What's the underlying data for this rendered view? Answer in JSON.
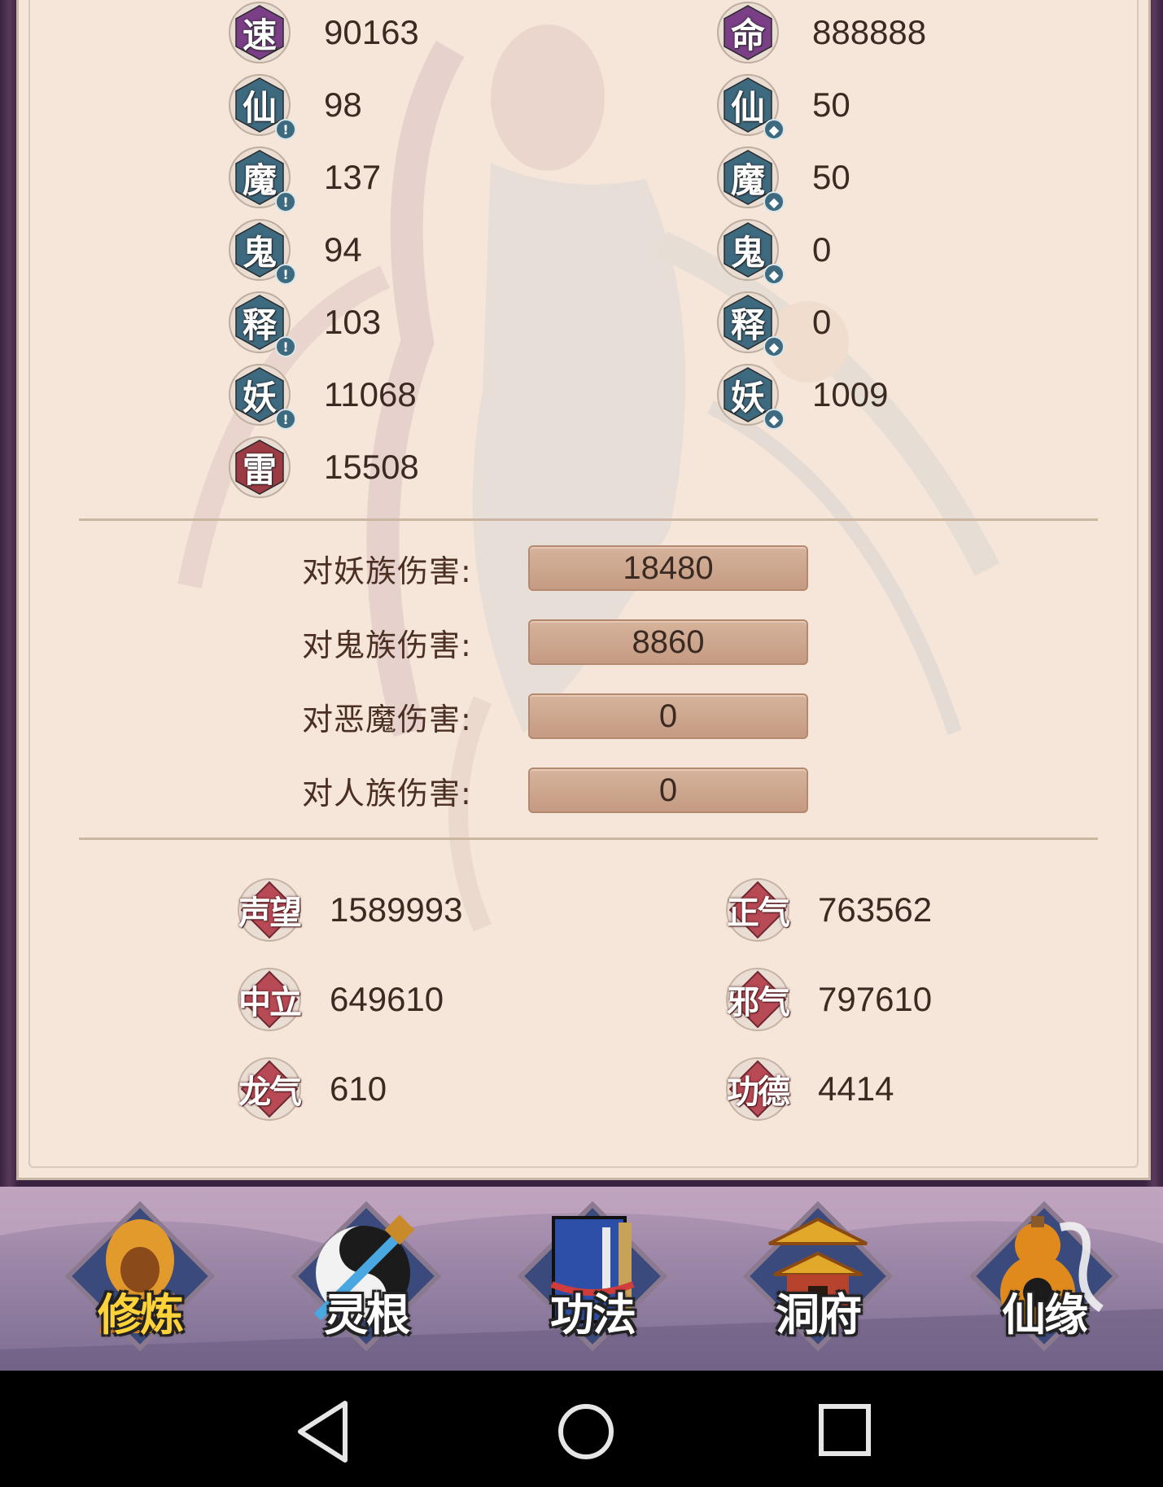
{
  "stats_left": [
    {
      "icon": "速",
      "value": "90163",
      "badge": false,
      "color": "#7a3f86"
    },
    {
      "icon": "仙",
      "value": "98",
      "badge": true,
      "color": "#3e6a80"
    },
    {
      "icon": "魔",
      "value": "137",
      "badge": true,
      "color": "#3e6a80"
    },
    {
      "icon": "鬼",
      "value": "94",
      "badge": true,
      "color": "#3e6a80"
    },
    {
      "icon": "释",
      "value": "103",
      "badge": true,
      "color": "#3e6a80"
    },
    {
      "icon": "妖",
      "value": "11068",
      "badge": true,
      "color": "#3e6a80"
    },
    {
      "icon": "雷",
      "value": "15508",
      "badge": false,
      "color": "#9c3b43"
    }
  ],
  "stats_right": [
    {
      "icon": "命",
      "value": "888888",
      "badge": false,
      "color": "#7a3f86"
    },
    {
      "icon": "仙",
      "value": "50",
      "badge": true,
      "color": "#3e6a80"
    },
    {
      "icon": "魔",
      "value": "50",
      "badge": true,
      "color": "#3e6a80"
    },
    {
      "icon": "鬼",
      "value": "0",
      "badge": true,
      "color": "#3e6a80"
    },
    {
      "icon": "释",
      "value": "0",
      "badge": true,
      "color": "#3e6a80"
    },
    {
      "icon": "妖",
      "value": "1009",
      "badge": true,
      "color": "#3e6a80"
    }
  ],
  "damage": [
    {
      "label": "对妖族伤害:",
      "value": "18480"
    },
    {
      "label": "对鬼族伤害:",
      "value": "8860"
    },
    {
      "label": "对恶魔伤害:",
      "value": "0"
    },
    {
      "label": "对人族伤害:",
      "value": "0"
    }
  ],
  "reputation_left": [
    {
      "label": "声望",
      "value": "1589993"
    },
    {
      "label": "中立",
      "value": "649610"
    },
    {
      "label": "龙气",
      "value": "610"
    }
  ],
  "reputation_right": [
    {
      "label": "正气",
      "value": "763562"
    },
    {
      "label": "邪气",
      "value": "797610"
    },
    {
      "label": "功德",
      "value": "4414"
    }
  ],
  "nav": [
    {
      "label": "修炼",
      "icon": "hooded-monk-icon"
    },
    {
      "label": "灵根",
      "icon": "yin-yang-sword-icon"
    },
    {
      "label": "功法",
      "icon": "book-icon"
    },
    {
      "label": "洞府",
      "icon": "pavilion-icon"
    },
    {
      "label": "仙缘",
      "icon": "gourd-icon"
    }
  ],
  "colors": {
    "panel_bg": "#f6e6da",
    "frame": "#3a2340",
    "rep_diamond": "#b84a56"
  }
}
